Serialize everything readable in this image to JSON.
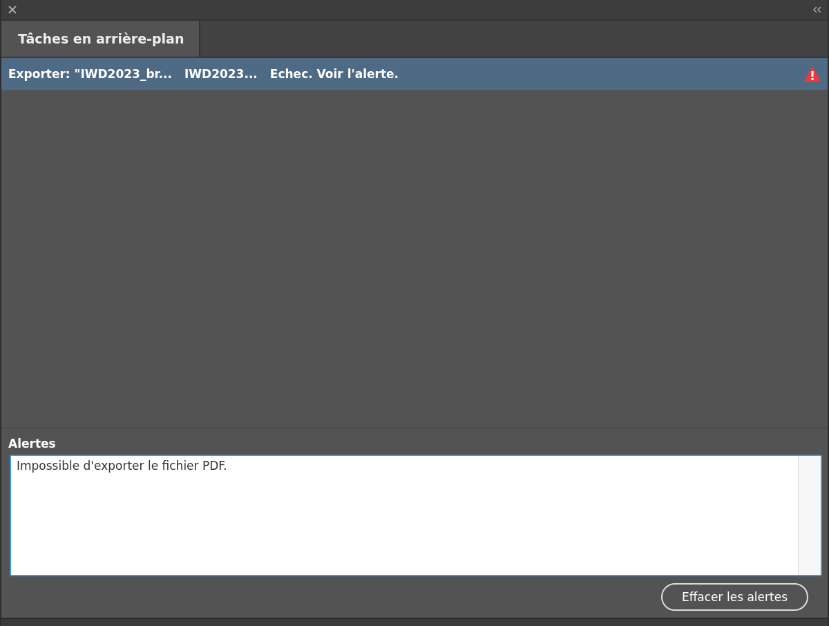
{
  "tabs": [
    {
      "label": "Tâches en arrière-plan",
      "selected": true
    }
  ],
  "tasks": [
    {
      "task": "Exporter: \"IWD2023_br...",
      "document": "IWD2023...",
      "status": "Echec. Voir l'alerte.",
      "selected": true,
      "kind": "error"
    }
  ],
  "alerts": {
    "label": "Alertes",
    "text": "Impossible d'exporter le fichier PDF."
  },
  "buttons": [
    "Effacer les alertes"
  ]
}
